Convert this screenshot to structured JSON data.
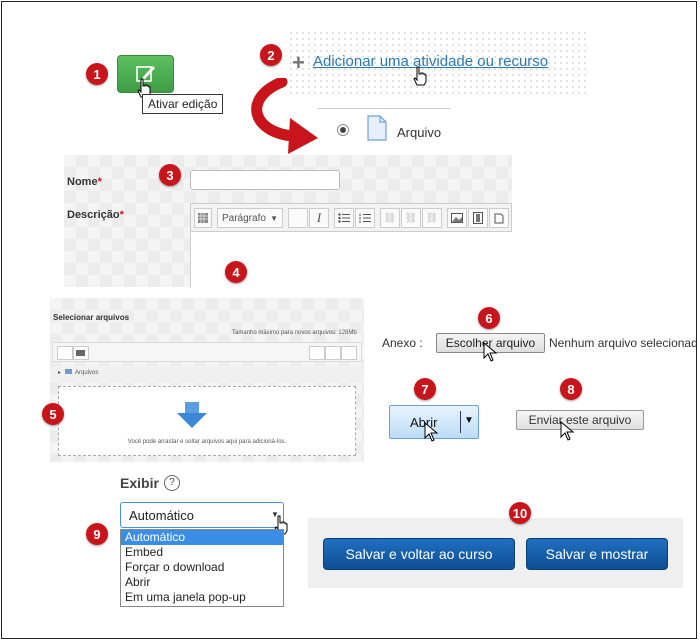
{
  "badges": [
    "1",
    "2",
    "3",
    "4",
    "5",
    "6",
    "7",
    "8",
    "9",
    "10"
  ],
  "edit": {
    "tooltip": "Ativar edição",
    "color": "#4caf50"
  },
  "add_activity": {
    "plus": "+",
    "label": "Adicionar uma atividade ou recurso"
  },
  "resource": {
    "label": "Arquivo"
  },
  "form": {
    "name_label": "Nome",
    "desc_label": "Descrição",
    "required": "*",
    "paragraph": "Parágrafo"
  },
  "filepicker": {
    "title": "Selecionar arquivos",
    "max_size": "Tamanho máximo para novos arquivos: 128Mb",
    "folder": "Arquivos",
    "drop_text": "Você pode arrastar e soltar arquivos aqui para adicioná-los."
  },
  "upload": {
    "attach_label": "Anexo :",
    "choose_button": "Escolher arquivo",
    "no_file": "Nenhum arquivo selecionado",
    "open_button": "Abrir",
    "send_button": "Enviar este arquivo"
  },
  "display": {
    "label": "Exibir",
    "help": "?",
    "selected": "Automático",
    "options": [
      "Automático",
      "Embed",
      "Forçar o download",
      "Abrir",
      "Em uma janela pop-up"
    ]
  },
  "actions": {
    "save_return": "Salvar e voltar ao curso",
    "save_show": "Salvar e mostrar"
  },
  "colors": {
    "badge": "#c8141b",
    "link": "#2a7ab0",
    "primary": "#155fa8",
    "arrow": "#c8141b"
  }
}
